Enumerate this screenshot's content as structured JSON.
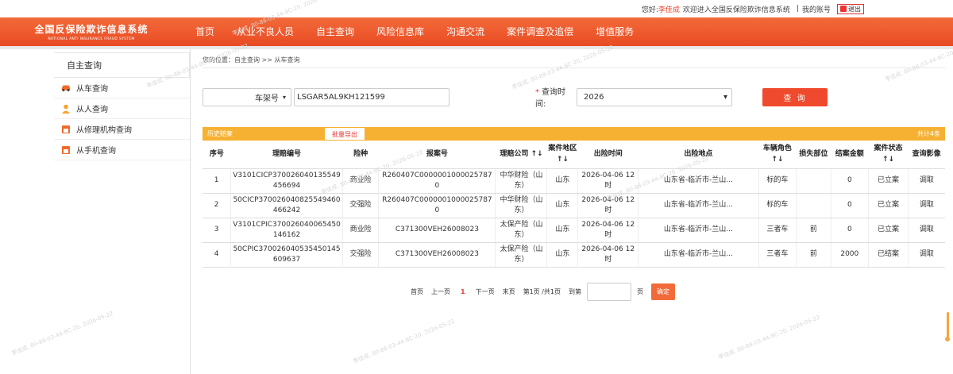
{
  "topbar": {
    "greeting": "您好:",
    "user": "李佳成",
    "welcome": "欢迎进入全国反保险欺诈信息系统",
    "sep": "|",
    "my_account": "我的账号",
    "logout": "退出"
  },
  "brand": {
    "title": "全国反保险欺诈信息系统",
    "subtitle": "NATIONAL ANTI INSURANCE FRAUD SYSTEM"
  },
  "menu": [
    "首页",
    "从业不良人员",
    "自主查询",
    "风险信息库",
    "沟通交流",
    "案件调查及追偿",
    "增值服务"
  ],
  "sidebar": {
    "header": "自主查询",
    "items": [
      {
        "label": "从车查询",
        "icon": "car-icon"
      },
      {
        "label": "从人查询",
        "icon": "person-icon"
      },
      {
        "label": "从修理机构查询",
        "icon": "repair-shop-icon"
      },
      {
        "label": "从手机查询",
        "icon": "phone-icon"
      }
    ]
  },
  "breadcrumb": "您的位置：自主查询 >> 从车查询",
  "query": {
    "type_select": "车架号",
    "vin_value": "LSGAR5AL9KH121599",
    "time_label": "查询时间:",
    "year_select": "2026",
    "submit": "查 询"
  },
  "history": {
    "title": "历史赔案",
    "batch_export": "批量导出",
    "total": "共计4条"
  },
  "table": {
    "headers": [
      "序号",
      "理赔编号",
      "险种",
      "报案号",
      "理赔公司 ↑↓",
      "案件地区↑↓",
      "出险时间",
      "出险地点",
      "车辆角色↑↓",
      "损失部位",
      "结案金额",
      "案件状态↑↓",
      "查询影像"
    ],
    "rows": [
      [
        "1",
        "V3101CICP370026040135549456694",
        "商业险",
        "R260407C00000010000257870",
        "中华财险（山东）",
        "山东",
        "2026-04-06 12时",
        "山东省-临沂市-兰山...",
        "标的车",
        "",
        "0",
        "已立案",
        "调取"
      ],
      [
        "2",
        "50CICP370026040825549460466242",
        "交强险",
        "R260407C00000010000257870",
        "中华财险（山东）",
        "山东",
        "2026-04-06 12时",
        "山东省-临沂市-兰山...",
        "标的车",
        "",
        "0",
        "已立案",
        "调取"
      ],
      [
        "3",
        "V3101CPIC370026040065450146162",
        "商业险",
        "C371300VEH26008023",
        "太保产险（山东）",
        "山东",
        "2026-04-06 12时",
        "山东省-临沂市-兰山...",
        "三者车",
        "前",
        "0",
        "已立案",
        "调取"
      ],
      [
        "4",
        "50CPIC370026040535450145609637",
        "交强险",
        "C371300VEH26008023",
        "太保产险（山东）",
        "山东",
        "2026-04-06 12时",
        "山东省-临沂市-兰山...",
        "三者车",
        "前",
        "2000",
        "已结案",
        "调取"
      ]
    ]
  },
  "pager": {
    "first": "首页",
    "prev": "上一页",
    "current": "1",
    "next": "下一页",
    "last": "末页",
    "info": "第1页 /共1页",
    "goto": "到第",
    "page_unit": "页",
    "confirm": "确定"
  },
  "watermark": "李佳成, 80-88-03-44-8C-20, 2026-05-22"
}
